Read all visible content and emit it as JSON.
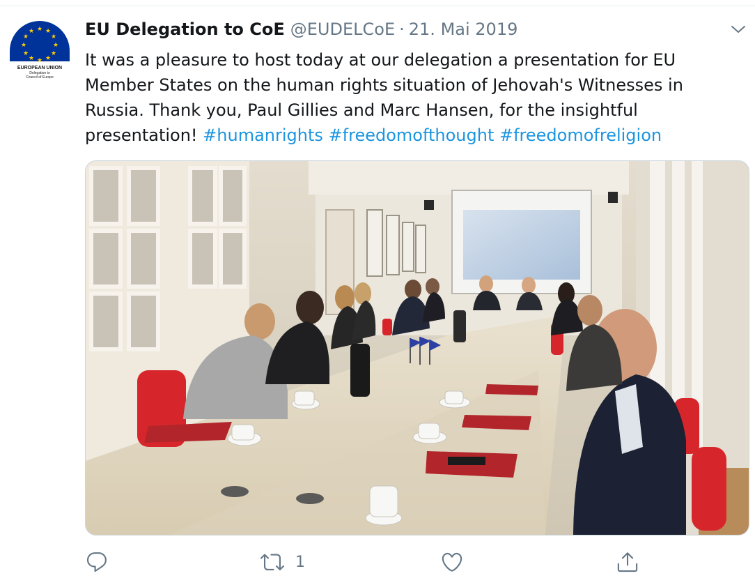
{
  "tweet": {
    "author": {
      "display_name": "EU Delegation to CoE",
      "handle": "@EUDELCoE",
      "separator": "·",
      "date": "21. Mai 2019",
      "avatar_text_line1": "EUROPEAN UNION",
      "avatar_text_line2": "Delegation to",
      "avatar_text_line3": "Council of Europe"
    },
    "text": {
      "line1": "It was a pleasure to host today at our delegation a presentation for EU",
      "line2": "Member States on the human rights situation of Jehovah's Witnesses in",
      "line3": "Russia. Thank you, Paul Gillies and Marc Hansen, for the insightful",
      "line4_prefix": "presentation! ",
      "hashtags": [
        "#humanrights",
        "#freedomofthought",
        "#freedomofreligion"
      ]
    },
    "actions": {
      "reply_icon": "reply-icon",
      "retweet_icon": "retweet-icon",
      "retweet_count": "1",
      "like_icon": "like-icon",
      "share_icon": "share-icon"
    }
  },
  "colors": {
    "text": "#14171a",
    "secondary": "#657786",
    "hashtag": "#1b95e0",
    "border": "#e6ecf0",
    "eu_blue": "#003399",
    "eu_gold": "#ffcc00"
  }
}
